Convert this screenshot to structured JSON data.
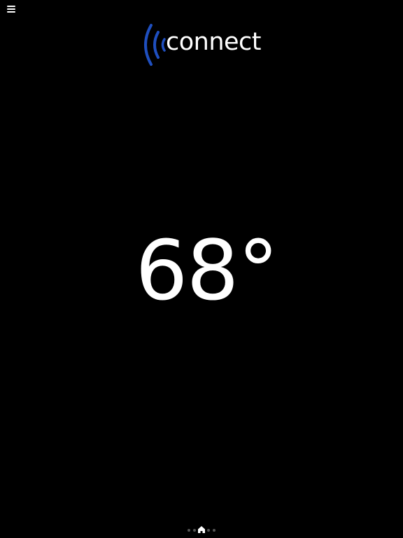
{
  "header": {
    "menu_icon": "hamburger-menu-icon",
    "logo": {
      "text": "connect",
      "icon": "signal-waves-icon",
      "wave_color": "#1f4fbf"
    }
  },
  "main": {
    "temperature": "68°"
  },
  "pager": {
    "pages": 5,
    "current": 2,
    "home_icon": "home-icon",
    "dot_color": "#555555",
    "active_color": "#ffffff"
  }
}
